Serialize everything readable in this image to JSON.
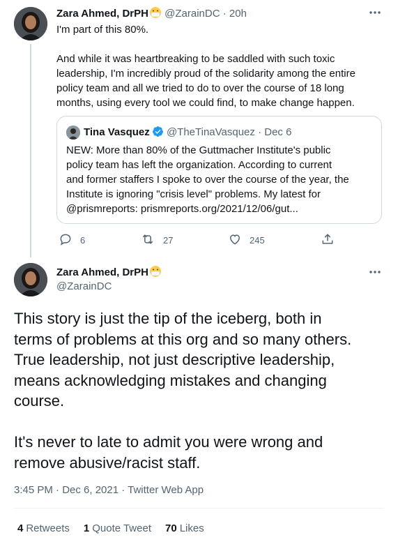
{
  "tweet1": {
    "author_name": "Zara Ahmed, DrPH",
    "handle": "@ZarainDC",
    "separator": "·",
    "time": "20h",
    "lines": [
      "I'm part of this 80%.",
      "",
      "And while it was heartbreaking to be saddled with such toxic",
      "leadership, I'm incredibly proud of the solidarity among the entire",
      "policy team and all we tried to do to over the course of 18 long",
      "months, using every tool we could find, to make change happen."
    ],
    "quote": {
      "author_name": "Tina Vasquez",
      "handle": "@TheTinaVasquez",
      "separator": "·",
      "date": "Dec 6",
      "lines": [
        "NEW: More than 80% of the Guttmacher Institute's public",
        "policy team has left the organization. According to current",
        "and former staffers I spoke to over the course of the year, the",
        "Institute is ignoring \"crisis level\" problems. My latest for",
        "@prismreports: prismreports.org/2021/12/06/gut..."
      ]
    },
    "actions": {
      "reply_count": "6",
      "retweet_count": "27",
      "like_count": "245"
    }
  },
  "tweet2": {
    "author_name": "Zara Ahmed, DrPH",
    "handle": "@ZarainDC",
    "lines": [
      "This story is just the tip of the iceberg, both in",
      "terms of problems at this org and so many others.",
      "True leadership, not just descriptive leadership,",
      "means acknowledging mistakes and changing",
      "course.",
      "",
      "It's never to late to admit you were wrong and",
      "remove abusive/racist staff."
    ],
    "timestamp": "3:45 PM · Dec 6, 2021 · Twitter Web App",
    "stats": {
      "retweets_count": "4",
      "retweets_label": "Retweets",
      "quotes_count": "1",
      "quotes_label": "Quote Tweet",
      "likes_count": "70",
      "likes_label": "Likes"
    }
  },
  "icons": [
    "mask-emoji-icon",
    "more-icon",
    "verified-icon",
    "reply-icon",
    "retweet-icon",
    "like-icon",
    "share-icon"
  ],
  "colors": {
    "text": "#0f1419",
    "muted": "#536471",
    "border": "#cfd9de",
    "verified": "#1d9bf0"
  }
}
